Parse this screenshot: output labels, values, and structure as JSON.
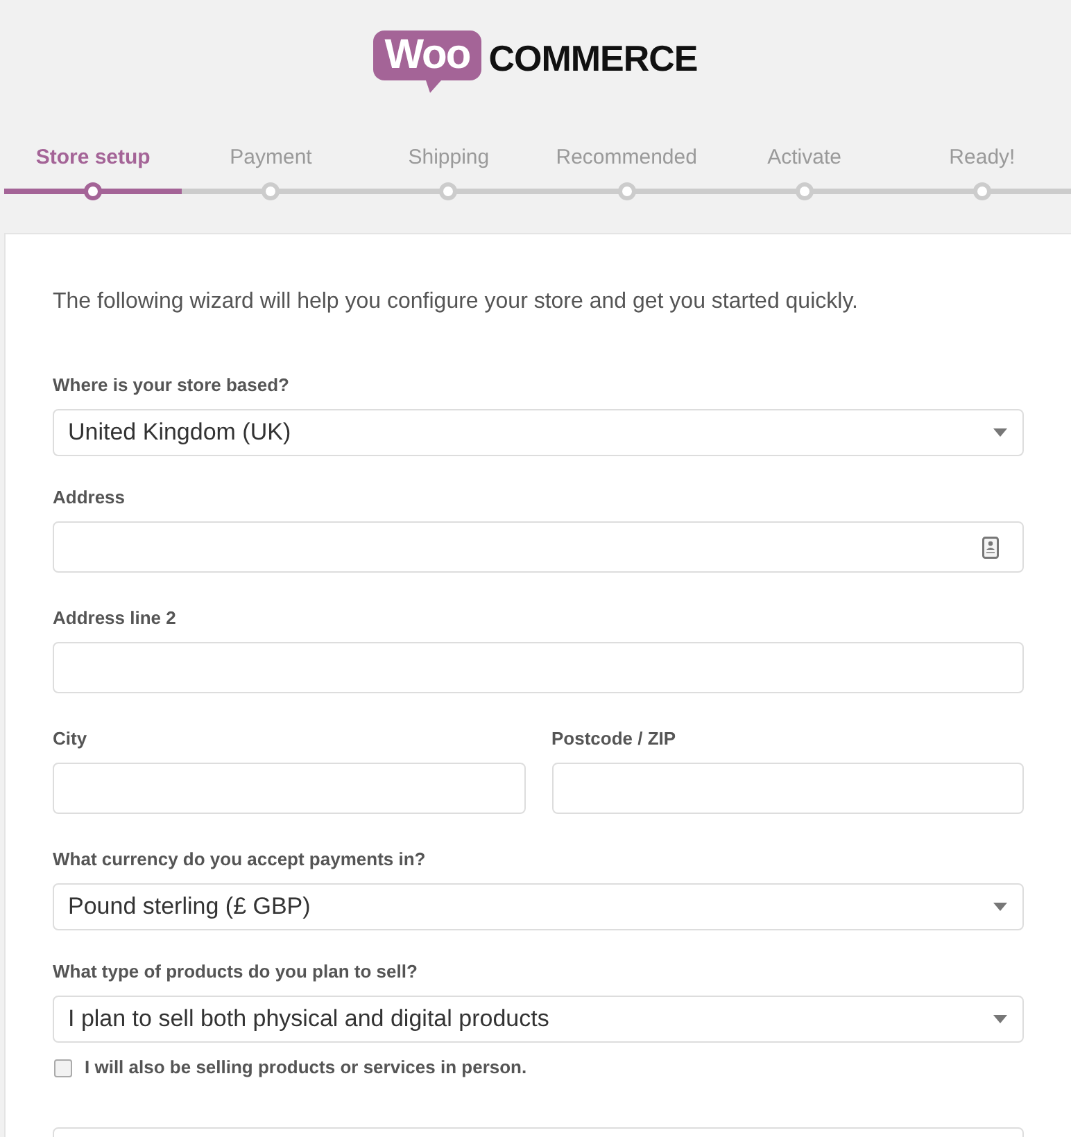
{
  "logo": {
    "badge": "Woo",
    "wordmark": "COMMERCE"
  },
  "steps": [
    {
      "label": "Store setup",
      "selected": true
    },
    {
      "label": "Payment",
      "selected": false
    },
    {
      "label": "Shipping",
      "selected": false
    },
    {
      "label": "Recommended",
      "selected": false
    },
    {
      "label": "Activate",
      "selected": false
    },
    {
      "label": "Ready!",
      "selected": false
    }
  ],
  "intro": "The following wizard will help you configure your store and get you started quickly.",
  "form_rows": [
    [
      {
        "kind": "select",
        "label": "Where is your store based?",
        "value": "United Kingdom (UK)"
      }
    ],
    [
      {
        "kind": "text",
        "label": "Address",
        "autofill_icon": true
      }
    ],
    [
      {
        "kind": "text",
        "label": "Address line 2"
      }
    ],
    [
      {
        "kind": "text",
        "label": "City"
      },
      {
        "kind": "text",
        "label": "Postcode / ZIP"
      }
    ],
    [
      {
        "kind": "select",
        "label": "What currency do you accept payments in?",
        "value": "Pound sterling (£ GBP)"
      }
    ],
    [
      {
        "kind": "select",
        "label": "What type of products do you plan to sell?",
        "value": "I plan to sell both physical and digital products"
      }
    ]
  ],
  "in_person_checkbox": {
    "label": "I will also be selling products or services in person.",
    "checked": false
  }
}
